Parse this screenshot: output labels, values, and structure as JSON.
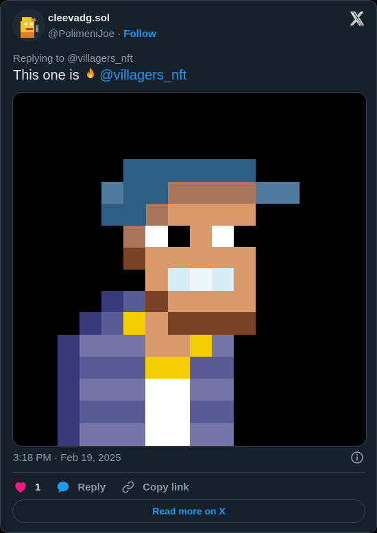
{
  "header": {
    "display_name": "cleevadg.sol",
    "handle": "@PolimeniJoe",
    "separator": "·",
    "follow_label": "Follow"
  },
  "tweet": {
    "replying_prefix": "Replying to ",
    "replying_to": "@villagers_nft",
    "text_before": "This one is ",
    "emoji": "fire",
    "mention": "@villagers_nft",
    "timestamp": "3:18 PM · Feb 19, 2025"
  },
  "actions": {
    "like_count": "1",
    "reply_label": "Reply",
    "copy_label": "Copy link"
  },
  "footer": {
    "read_more_label": "Read more on X"
  },
  "colors": {
    "background": "#15202b",
    "border": "#38444d",
    "accent": "#1d9bf0",
    "like": "#f91880",
    "muted": "#8b98a5",
    "text": "#e7e9ea"
  },
  "icons": {
    "brand": "x-logo-icon",
    "info": "info-icon",
    "like": "heart-icon",
    "reply": "speech-bubble-icon",
    "copy": "link-icon"
  }
}
